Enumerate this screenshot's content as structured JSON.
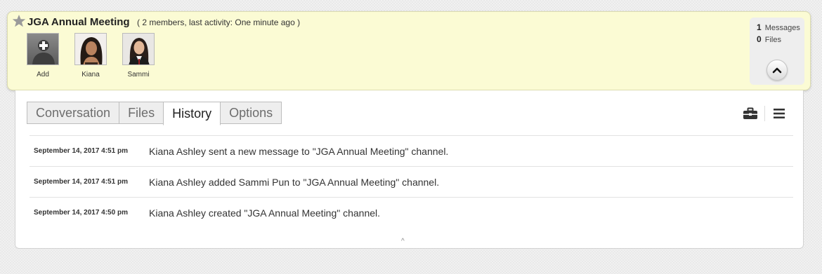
{
  "channel": {
    "title": "JGA Annual Meeting",
    "subtitle": "( 2 members, last activity: One minute ago )",
    "starred": false
  },
  "members": [
    {
      "label": "Add",
      "icon": "add-user-icon"
    },
    {
      "label": "Kiana",
      "icon": "person-photo"
    },
    {
      "label": "Sammi",
      "icon": "person-photo"
    }
  ],
  "stats": {
    "messages_count": "1",
    "messages_label": "Messages",
    "files_count": "0",
    "files_label": "Files"
  },
  "tabs": [
    {
      "label": "Conversation",
      "active": false
    },
    {
      "label": "Files",
      "active": false
    },
    {
      "label": "History",
      "active": true
    },
    {
      "label": "Options",
      "active": false
    }
  ],
  "toolbar": {
    "icons": [
      "briefcase-icon",
      "hamburger-menu-icon"
    ]
  },
  "history": [
    {
      "date": "September 14, 2017 4:51 pm",
      "text": "Kiana Ashley sent a new message to \"JGA Annual Meeting\" channel."
    },
    {
      "date": "September 14, 2017 4:51 pm",
      "text": "Kiana Ashley added Sammi Pun to \"JGA Annual Meeting\" channel."
    },
    {
      "date": "September 14, 2017 4:50 pm",
      "text": "Kiana Ashley created \"JGA Annual Meeting\" channel."
    }
  ],
  "colors": {
    "header_bg": "#fbfbd4",
    "tab_active_bg": "#ffffff",
    "tab_inactive_bg": "#eeeeee"
  }
}
